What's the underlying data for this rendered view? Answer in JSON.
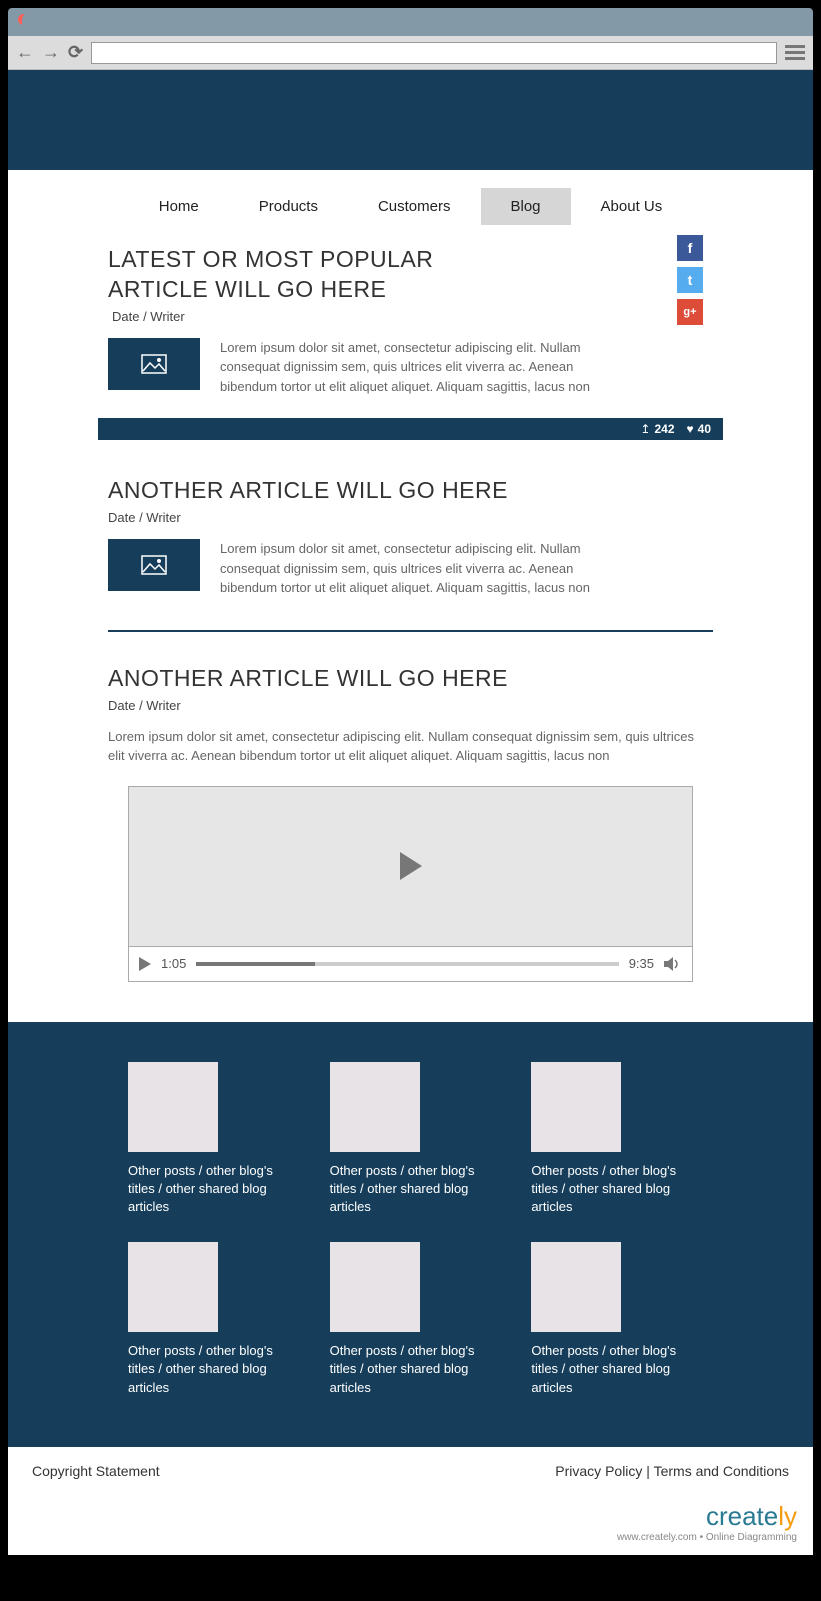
{
  "nav": {
    "items": [
      "Home",
      "Products",
      "Customers",
      "Blog",
      "About Us"
    ],
    "active": "Blog"
  },
  "article1": {
    "title": "LATEST OR MOST POPULAR ARTICLE WILL GO HERE",
    "meta": "Date / Writer",
    "excerpt": "Lorem ipsum dolor sit amet, consectetur adipiscing elit. Nullam consequat dignissim sem, quis ultrices elit viverra ac. Aenean bibendum tortor ut elit aliquet aliquet. Aliquam sagittis, lacus non"
  },
  "stats": {
    "uploads": "242",
    "likes": "40"
  },
  "article2": {
    "title": "ANOTHER ARTICLE WILL GO HERE",
    "meta": "Date / Writer",
    "excerpt": "Lorem ipsum dolor sit amet, consectetur adipiscing elit. Nullam consequat dignissim sem, quis ultrices elit viverra ac. Aenean bibendum tortor ut elit aliquet aliquet. Aliquam sagittis, lacus non"
  },
  "article3": {
    "title": "ANOTHER ARTICLE WILL GO HERE",
    "meta": "Date / Writer",
    "excerpt": "Lorem ipsum dolor sit amet, consectetur adipiscing elit. Nullam consequat dignissim sem, quis ultrices elit viverra ac. Aenean bibendum tortor ut elit aliquet aliquet. Aliquam sagittis, lacus non"
  },
  "video": {
    "current": "1:05",
    "total": "9:35"
  },
  "grid_text": "Other posts / other blog's titles / other shared blog articles",
  "footer": {
    "copyright": "Copyright Statement",
    "privacy": "Privacy Policy",
    "sep": " | ",
    "terms": "Terms and Conditions"
  },
  "brand": {
    "name1": "create",
    "name2": "ly",
    "sub": "www.creately.com • Online Diagramming"
  },
  "social": {
    "fb": "f",
    "tw": "t",
    "gp": "g+"
  }
}
